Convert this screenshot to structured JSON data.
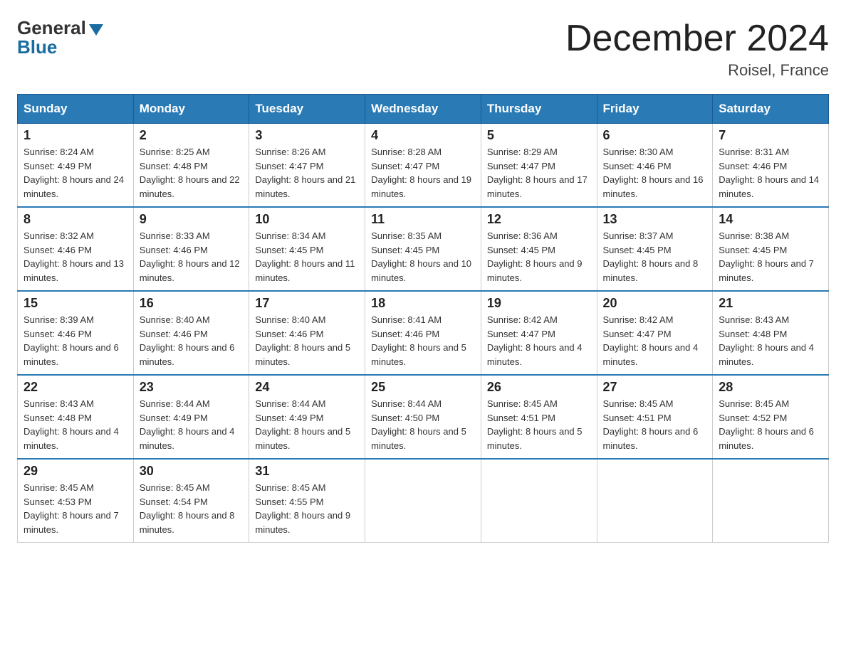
{
  "header": {
    "logo_general": "General",
    "logo_blue": "Blue",
    "month_title": "December 2024",
    "location": "Roisel, France"
  },
  "days_of_week": [
    "Sunday",
    "Monday",
    "Tuesday",
    "Wednesday",
    "Thursday",
    "Friday",
    "Saturday"
  ],
  "weeks": [
    [
      {
        "day": "1",
        "sunrise": "8:24 AM",
        "sunset": "4:49 PM",
        "daylight": "8 hours and 24 minutes."
      },
      {
        "day": "2",
        "sunrise": "8:25 AM",
        "sunset": "4:48 PM",
        "daylight": "8 hours and 22 minutes."
      },
      {
        "day": "3",
        "sunrise": "8:26 AM",
        "sunset": "4:47 PM",
        "daylight": "8 hours and 21 minutes."
      },
      {
        "day": "4",
        "sunrise": "8:28 AM",
        "sunset": "4:47 PM",
        "daylight": "8 hours and 19 minutes."
      },
      {
        "day": "5",
        "sunrise": "8:29 AM",
        "sunset": "4:47 PM",
        "daylight": "8 hours and 17 minutes."
      },
      {
        "day": "6",
        "sunrise": "8:30 AM",
        "sunset": "4:46 PM",
        "daylight": "8 hours and 16 minutes."
      },
      {
        "day": "7",
        "sunrise": "8:31 AM",
        "sunset": "4:46 PM",
        "daylight": "8 hours and 14 minutes."
      }
    ],
    [
      {
        "day": "8",
        "sunrise": "8:32 AM",
        "sunset": "4:46 PM",
        "daylight": "8 hours and 13 minutes."
      },
      {
        "day": "9",
        "sunrise": "8:33 AM",
        "sunset": "4:46 PM",
        "daylight": "8 hours and 12 minutes."
      },
      {
        "day": "10",
        "sunrise": "8:34 AM",
        "sunset": "4:45 PM",
        "daylight": "8 hours and 11 minutes."
      },
      {
        "day": "11",
        "sunrise": "8:35 AM",
        "sunset": "4:45 PM",
        "daylight": "8 hours and 10 minutes."
      },
      {
        "day": "12",
        "sunrise": "8:36 AM",
        "sunset": "4:45 PM",
        "daylight": "8 hours and 9 minutes."
      },
      {
        "day": "13",
        "sunrise": "8:37 AM",
        "sunset": "4:45 PM",
        "daylight": "8 hours and 8 minutes."
      },
      {
        "day": "14",
        "sunrise": "8:38 AM",
        "sunset": "4:45 PM",
        "daylight": "8 hours and 7 minutes."
      }
    ],
    [
      {
        "day": "15",
        "sunrise": "8:39 AM",
        "sunset": "4:46 PM",
        "daylight": "8 hours and 6 minutes."
      },
      {
        "day": "16",
        "sunrise": "8:40 AM",
        "sunset": "4:46 PM",
        "daylight": "8 hours and 6 minutes."
      },
      {
        "day": "17",
        "sunrise": "8:40 AM",
        "sunset": "4:46 PM",
        "daylight": "8 hours and 5 minutes."
      },
      {
        "day": "18",
        "sunrise": "8:41 AM",
        "sunset": "4:46 PM",
        "daylight": "8 hours and 5 minutes."
      },
      {
        "day": "19",
        "sunrise": "8:42 AM",
        "sunset": "4:47 PM",
        "daylight": "8 hours and 4 minutes."
      },
      {
        "day": "20",
        "sunrise": "8:42 AM",
        "sunset": "4:47 PM",
        "daylight": "8 hours and 4 minutes."
      },
      {
        "day": "21",
        "sunrise": "8:43 AM",
        "sunset": "4:48 PM",
        "daylight": "8 hours and 4 minutes."
      }
    ],
    [
      {
        "day": "22",
        "sunrise": "8:43 AM",
        "sunset": "4:48 PM",
        "daylight": "8 hours and 4 minutes."
      },
      {
        "day": "23",
        "sunrise": "8:44 AM",
        "sunset": "4:49 PM",
        "daylight": "8 hours and 4 minutes."
      },
      {
        "day": "24",
        "sunrise": "8:44 AM",
        "sunset": "4:49 PM",
        "daylight": "8 hours and 5 minutes."
      },
      {
        "day": "25",
        "sunrise": "8:44 AM",
        "sunset": "4:50 PM",
        "daylight": "8 hours and 5 minutes."
      },
      {
        "day": "26",
        "sunrise": "8:45 AM",
        "sunset": "4:51 PM",
        "daylight": "8 hours and 5 minutes."
      },
      {
        "day": "27",
        "sunrise": "8:45 AM",
        "sunset": "4:51 PM",
        "daylight": "8 hours and 6 minutes."
      },
      {
        "day": "28",
        "sunrise": "8:45 AM",
        "sunset": "4:52 PM",
        "daylight": "8 hours and 6 minutes."
      }
    ],
    [
      {
        "day": "29",
        "sunrise": "8:45 AM",
        "sunset": "4:53 PM",
        "daylight": "8 hours and 7 minutes."
      },
      {
        "day": "30",
        "sunrise": "8:45 AM",
        "sunset": "4:54 PM",
        "daylight": "8 hours and 8 minutes."
      },
      {
        "day": "31",
        "sunrise": "8:45 AM",
        "sunset": "4:55 PM",
        "daylight": "8 hours and 9 minutes."
      },
      null,
      null,
      null,
      null
    ]
  ]
}
